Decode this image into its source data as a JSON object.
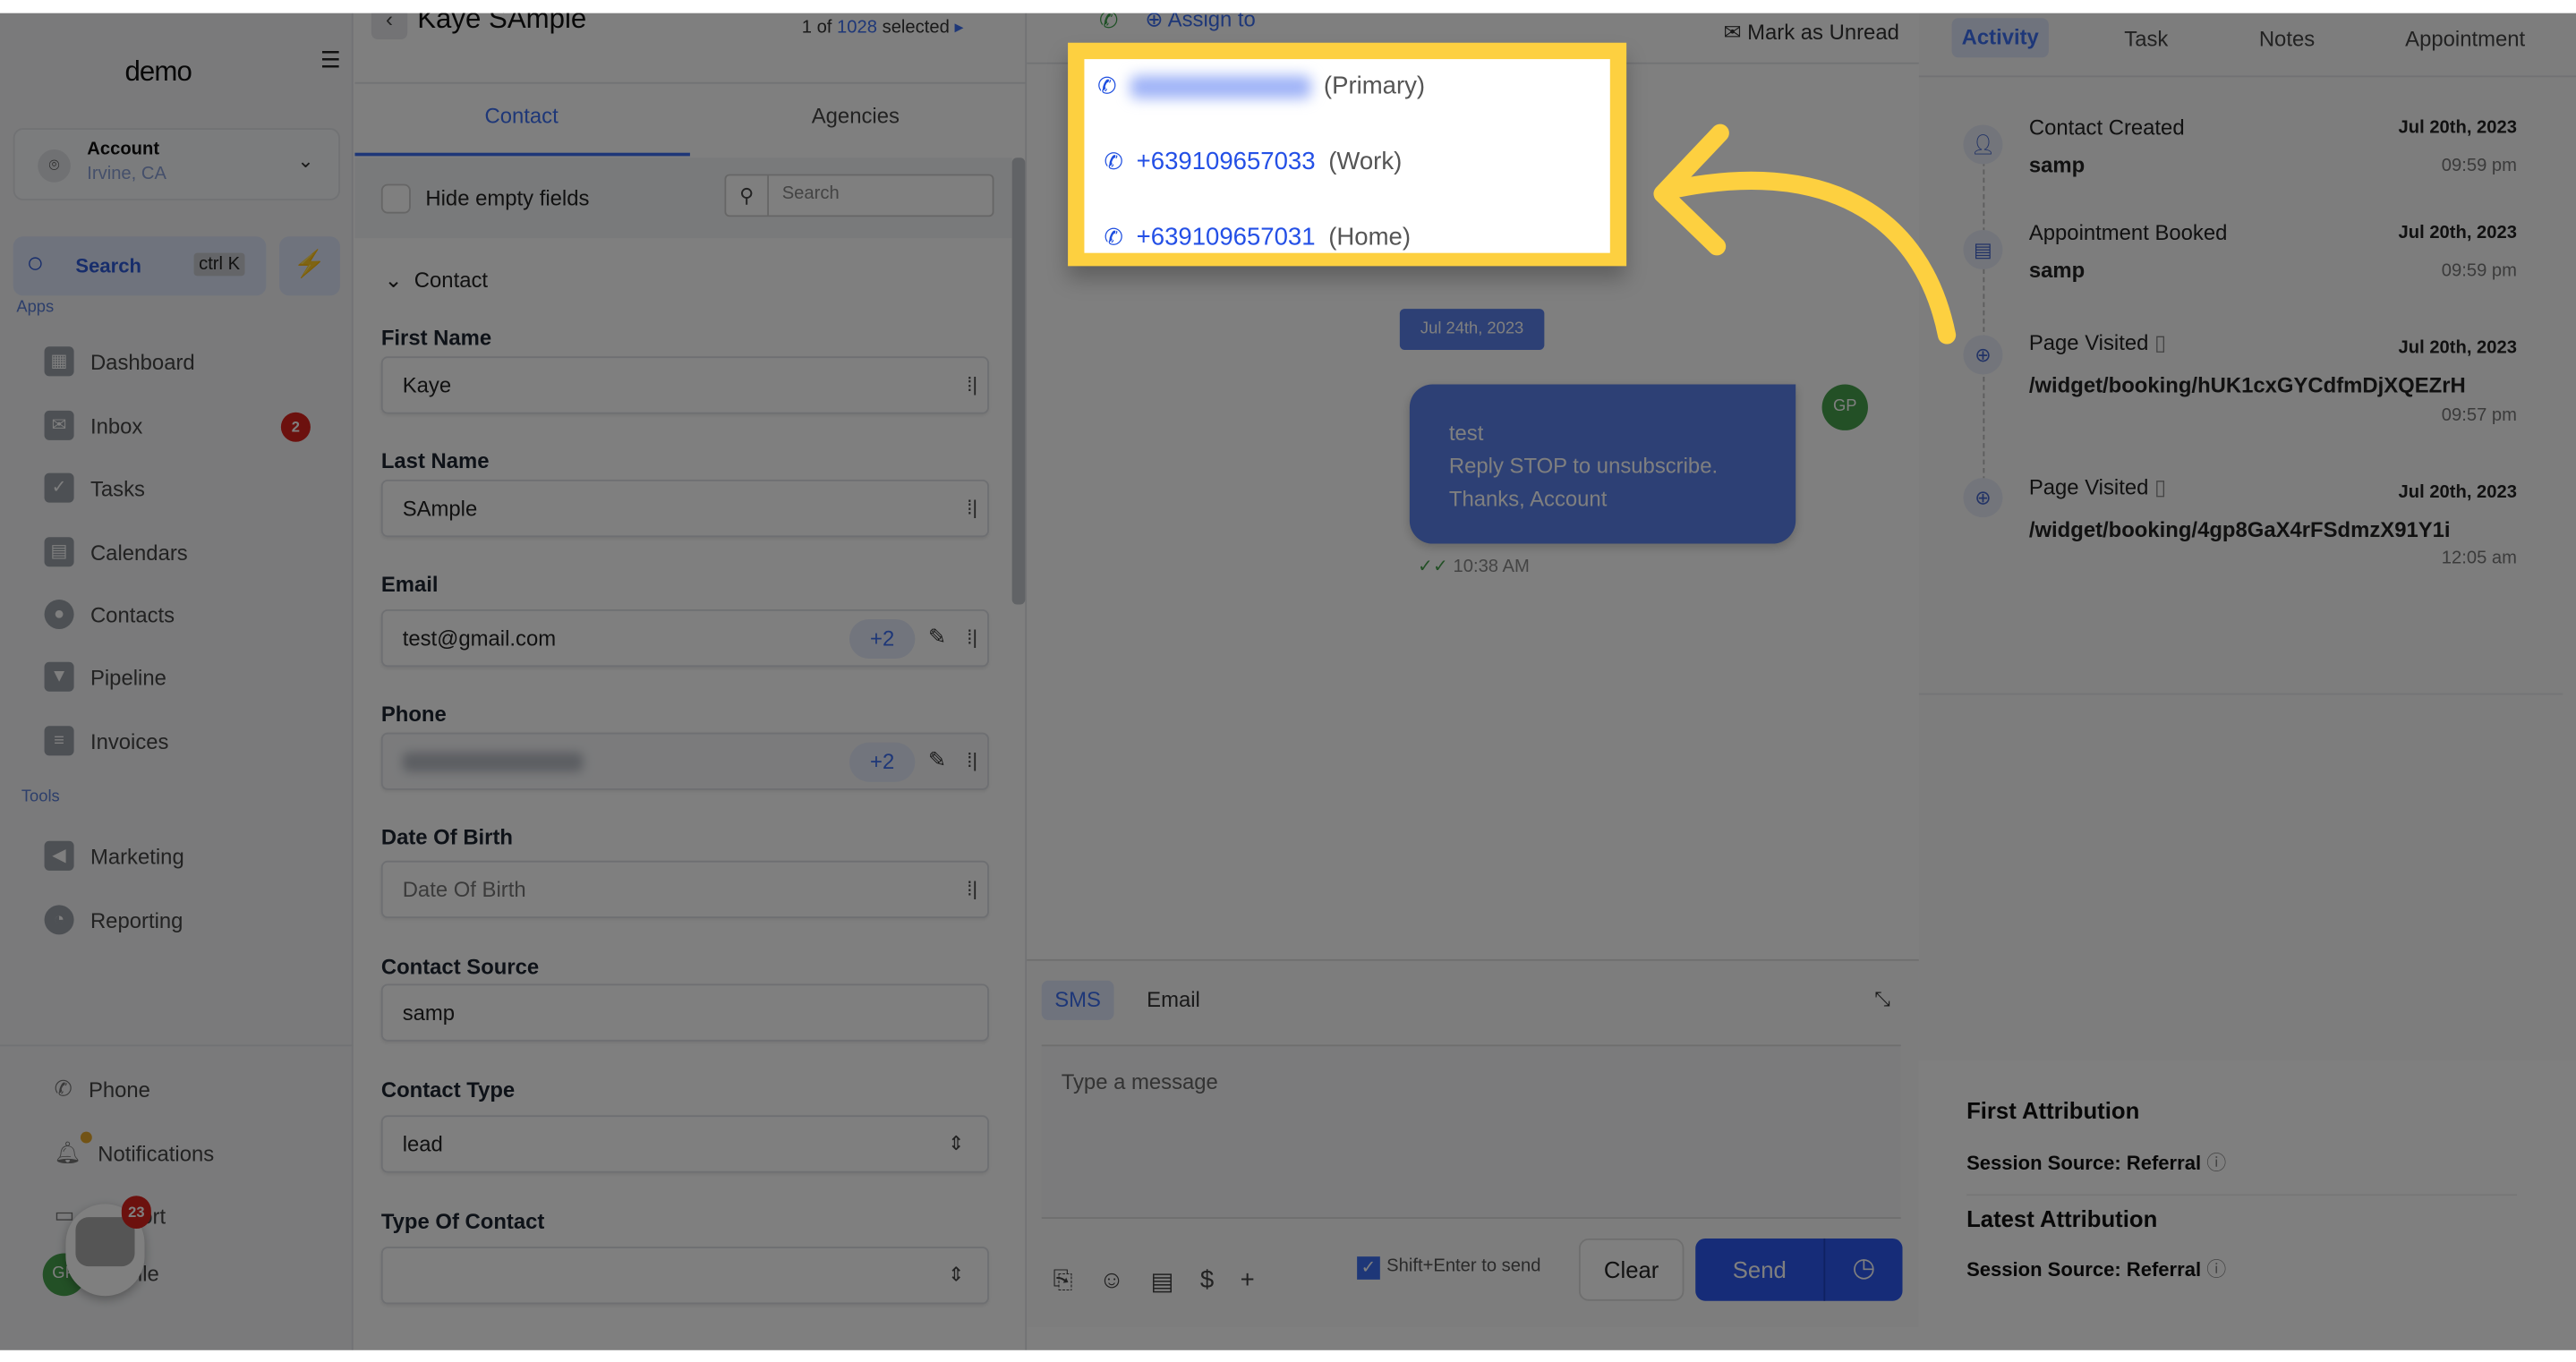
{
  "sidebar": {
    "logo": "demo",
    "account": {
      "name": "Account",
      "location": "Irvine, CA"
    },
    "search": {
      "label": "Search",
      "shortcut": "ctrl K"
    },
    "apps_label": "Apps",
    "tools_label": "Tools",
    "apps": [
      {
        "label": "Dashboard"
      },
      {
        "label": "Inbox",
        "badge": "2"
      },
      {
        "label": "Tasks"
      },
      {
        "label": "Calendars"
      },
      {
        "label": "Contacts"
      },
      {
        "label": "Pipeline"
      },
      {
        "label": "Invoices"
      }
    ],
    "tools": [
      {
        "label": "Marketing"
      },
      {
        "label": "Reporting"
      }
    ],
    "bottom": [
      {
        "label": "Phone"
      },
      {
        "label": "Notifications"
      },
      {
        "label": "Support"
      },
      {
        "label": "Profile"
      }
    ],
    "chat_badge": "23",
    "avatar_initials": "GP"
  },
  "contact": {
    "name": "Kaye SAmple",
    "pager": {
      "prefix": "1 of",
      "total": "1028",
      "suffix": "selected"
    },
    "tabs": [
      "Contact",
      "Agencies"
    ],
    "hide_empty": "Hide empty fields",
    "search_placeholder": "Search",
    "section": "Contact",
    "fields": {
      "first_name": {
        "label": "First Name",
        "value": "Kaye"
      },
      "last_name": {
        "label": "Last Name",
        "value": "SAmple"
      },
      "email": {
        "label": "Email",
        "value": "test@gmail.com",
        "more": "+2"
      },
      "phone": {
        "label": "Phone",
        "more": "+2"
      },
      "dob": {
        "label": "Date Of Birth",
        "placeholder": "Date Of Birth"
      },
      "source": {
        "label": "Contact Source",
        "value": "samp"
      },
      "type": {
        "label": "Contact Type",
        "value": "lead"
      },
      "type_of_contact": {
        "label": "Type Of Contact",
        "value": ""
      }
    }
  },
  "conversation": {
    "assign": "Assign to",
    "mark_unread": "Mark as Unread",
    "date_pill": "Jul 24th, 2023",
    "message": {
      "lines": [
        "test",
        "Reply STOP to unsubscribe.",
        "Thanks, Account"
      ],
      "time": "10:38 AM",
      "avatar": "GP"
    },
    "composer": {
      "tabs": [
        "SMS",
        "Email"
      ],
      "placeholder": "Type a message",
      "shift_enter": "Shift+Enter to send",
      "clear": "Clear",
      "send": "Send"
    }
  },
  "phone_popup": {
    "items": [
      {
        "number": "",
        "type": "(Primary)"
      },
      {
        "number": "+639109657033",
        "type": "(Work)"
      },
      {
        "number": "+639109657031",
        "type": "(Home)"
      }
    ],
    "highlight_color": "#fdd040"
  },
  "right": {
    "tabs": [
      "Activity",
      "Task",
      "Notes",
      "Appointment"
    ],
    "activity": [
      {
        "title": "Contact Created",
        "date": "Jul 20th, 2023",
        "sub": "samp",
        "time": "09:59 pm"
      },
      {
        "title": "Appointment Booked",
        "date": "Jul 20th, 2023",
        "sub": "samp",
        "time": "09:59 pm"
      },
      {
        "title": "Page Visited",
        "date": "Jul 20th, 2023",
        "sub": "/widget/booking/hUK1cxGYCdfmDjXQEZrH",
        "time": "09:57 pm"
      },
      {
        "title": "Page Visited",
        "date": "Jul 20th, 2023",
        "sub": "/widget/booking/4gp8GaX4rFSdmzX91Y1i",
        "time": "12:05 am"
      }
    ],
    "first_attr": "First Attribution",
    "first_src": "Session Source: Referral",
    "latest_attr": "Latest Attribution",
    "latest_src": "Session Source: Referral"
  }
}
